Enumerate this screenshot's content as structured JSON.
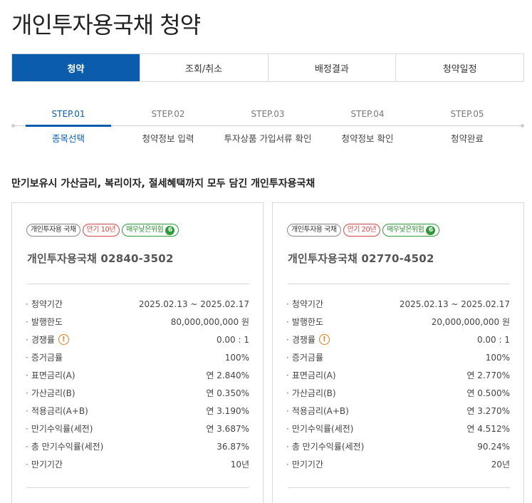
{
  "page": {
    "title": "개인투자용국채 청약"
  },
  "tabs": [
    {
      "label": "청약"
    },
    {
      "label": "조회/취소"
    },
    {
      "label": "배정결과"
    },
    {
      "label": "청약일정"
    }
  ],
  "steps": [
    {
      "num": "STEP.01",
      "label": "종목선택"
    },
    {
      "num": "STEP.02",
      "label": "청약정보 입력"
    },
    {
      "num": "STEP.03",
      "label": "투자상품 가입서류 확인"
    },
    {
      "num": "STEP.04",
      "label": "청약정보 확인"
    },
    {
      "num": "STEP.05",
      "label": "청약완료"
    }
  ],
  "headline": "만기보유시 가산금리, 복리이자, 절세혜택까지 모두 담긴 개인투자용국채",
  "cards": [
    {
      "badges": {
        "type": "개인투자용 국채",
        "maturity": "만기 10년",
        "risk": "매우낮은위험",
        "risk_level": "6"
      },
      "name": "개인투자용국채 02840-3502",
      "rows": [
        {
          "k": "청약기간",
          "v": "2025.02.13 ~ 2025.02.17"
        },
        {
          "k": "발행한도",
          "v": "80,000,000,000 원"
        },
        {
          "k": "경쟁률",
          "v": "0.00 : 1"
        },
        {
          "k": "증거금률",
          "v": "100%"
        },
        {
          "k": "표면금리(A)",
          "v": "연 2.840%"
        },
        {
          "k": "가산금리(B)",
          "v": "연 0.350%"
        },
        {
          "k": "적용금리(A+B)",
          "v": "연 3.190%"
        },
        {
          "k": "만기수익률(세전)",
          "v": "연 3.687%"
        },
        {
          "k": "총 만기수익률(세전)",
          "v": "36.87%"
        },
        {
          "k": "만기기간",
          "v": "10년"
        }
      ]
    },
    {
      "badges": {
        "type": "개인투자용 국채",
        "maturity": "만기 20년",
        "risk": "매우낮은위험",
        "risk_level": "6"
      },
      "name": "개인투자용국채 02770-4502",
      "rows": [
        {
          "k": "청약기간",
          "v": "2025.02.13 ~ 2025.02.17"
        },
        {
          "k": "발행한도",
          "v": "20,000,000,000 원"
        },
        {
          "k": "경쟁률",
          "v": "0.00 : 1"
        },
        {
          "k": "증거금률",
          "v": "100%"
        },
        {
          "k": "표면금리(A)",
          "v": "연 2.770%"
        },
        {
          "k": "가산금리(B)",
          "v": "연 0.500%"
        },
        {
          "k": "적용금리(A+B)",
          "v": "연 3.270%"
        },
        {
          "k": "만기수익률(세전)",
          "v": "연 4.512%"
        },
        {
          "k": "총 만기수익률(세전)",
          "v": "90.24%"
        },
        {
          "k": "만기기간",
          "v": "20년"
        }
      ]
    }
  ],
  "icons": {
    "competition_warning": "exclamation-circle-icon"
  },
  "colors": {
    "primary": "#0b5cad",
    "maturity_badge": "#d64545",
    "risk_badge": "#2f9a3a",
    "warning": "#e07b1a"
  }
}
